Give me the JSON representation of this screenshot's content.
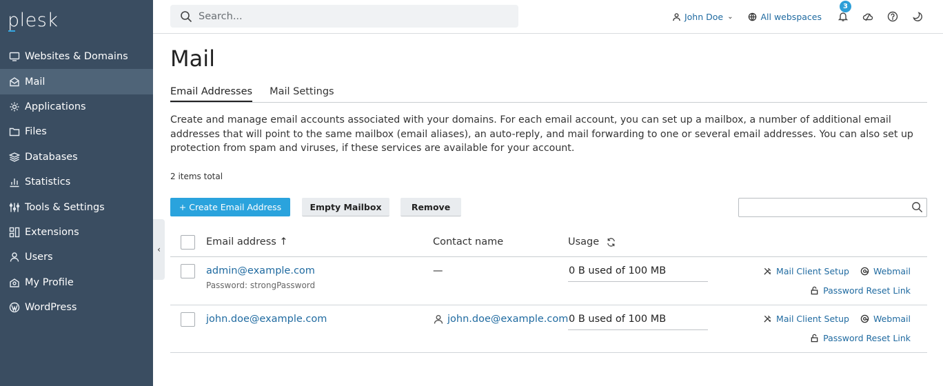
{
  "brand": {
    "logo": "plesk",
    "accent": "#35a6e0",
    "sidebar_bg": "#3a4d61"
  },
  "sidebar": {
    "items": [
      {
        "label": "Websites & Domains",
        "icon": "monitor-icon"
      },
      {
        "label": "Mail",
        "icon": "envelope-icon",
        "active": true
      },
      {
        "label": "Applications",
        "icon": "gear-icon"
      },
      {
        "label": "Files",
        "icon": "folder-icon"
      },
      {
        "label": "Databases",
        "icon": "layers-icon"
      },
      {
        "label": "Statistics",
        "icon": "bar-chart-icon"
      },
      {
        "label": "Tools & Settings",
        "icon": "sliders-icon"
      },
      {
        "label": "Extensions",
        "icon": "blocks-icon"
      },
      {
        "label": "Users",
        "icon": "user-icon"
      },
      {
        "label": "My Profile",
        "icon": "profile-icon"
      },
      {
        "label": "WordPress",
        "icon": "wordpress-icon"
      }
    ],
    "collapse_glyph": "‹"
  },
  "topbar": {
    "search_placeholder": "Search...",
    "user": "John Doe",
    "user_chevron": "⌄",
    "webspaces": "All webspaces",
    "notifications_count": "3"
  },
  "page": {
    "title": "Mail",
    "tabs": [
      "Email Addresses",
      "Mail Settings"
    ],
    "active_tab": "Email Addresses",
    "description": "Create and manage email accounts associated with your domains. For each email account, you can set up a mailbox, a number of additional email addresses that will point to the same mailbox (email aliases), an auto-reply, and mail forwarding to one or several email addresses. You can also set up protection from spam and viruses, if these services are available for your account.",
    "items_total": "2 items total"
  },
  "toolbar": {
    "create_label": "+ Create Email Address",
    "empty_label": "Empty Mailbox",
    "remove_label": "Remove"
  },
  "table": {
    "headers": {
      "email": "Email address ↑",
      "contact": "Contact name",
      "usage": "Usage"
    },
    "rows": [
      {
        "email": "admin@example.com",
        "password_note": "Password: strongPassword",
        "contact": "—",
        "usage": "0 B used of 100 MB",
        "actions": {
          "setup": "Mail Client Setup",
          "webmail": "Webmail",
          "reset": "Password Reset Link"
        }
      },
      {
        "email": "john.doe@example.com",
        "contact": "john.doe@example.com",
        "usage": "0 B used of 100 MB",
        "actions": {
          "setup": "Mail Client Setup",
          "webmail": "Webmail",
          "reset": "Password Reset Link"
        }
      }
    ]
  }
}
